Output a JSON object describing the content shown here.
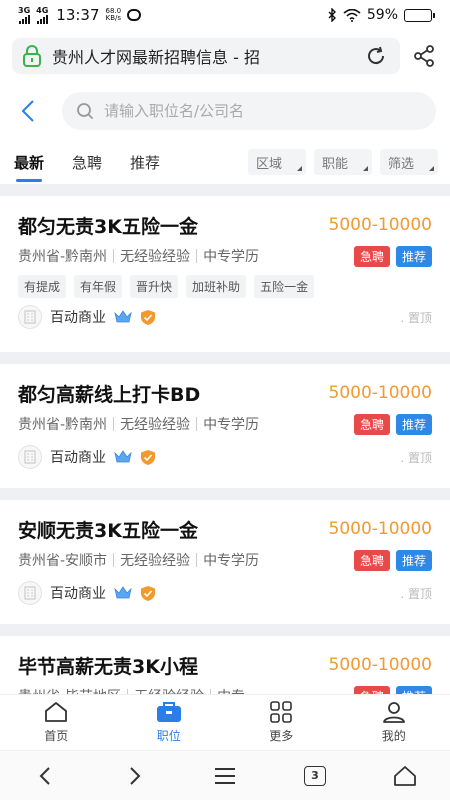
{
  "status_bar": {
    "signal1": "3G",
    "signal2": "4G",
    "time": "13:37",
    "net_speed_value": "68.0",
    "net_speed_unit": "KB/s",
    "battery": "59%",
    "battery_level": 0.59
  },
  "browser": {
    "page_title": "贵州人才网最新招聘信息 - 招",
    "tab_count": "3"
  },
  "search": {
    "placeholder": "请输入职位名/公司名"
  },
  "tabs": [
    {
      "label": "最新"
    },
    {
      "label": "急聘"
    },
    {
      "label": "推荐"
    }
  ],
  "filters": [
    {
      "label": "区域"
    },
    {
      "label": "职能"
    },
    {
      "label": "筛选"
    }
  ],
  "jobs": [
    {
      "title": "都匀无责3K五险一金",
      "salary": "5000-10000",
      "location": "贵州省-黔南州",
      "experience": "无经验经验",
      "education": "中专学历",
      "badge_urgent": "急聘",
      "badge_recommend": "推荐",
      "tags": [
        "有提成",
        "有年假",
        "晋升快",
        "加班补助",
        "五险一金"
      ],
      "company": "百动商业",
      "pin": "置顶"
    },
    {
      "title": "都匀高薪线上打卡BD",
      "salary": "5000-10000",
      "location": "贵州省-黔南州",
      "experience": "无经验经验",
      "education": "中专学历",
      "badge_urgent": "急聘",
      "badge_recommend": "推荐",
      "company": "百动商业",
      "pin": "置顶"
    },
    {
      "title": "安顺无责3K五险一金",
      "salary": "5000-10000",
      "location": "贵州省-安顺市",
      "experience": "无经验经验",
      "education": "中专学历",
      "badge_urgent": "急聘",
      "badge_recommend": "推荐",
      "company": "百动商业",
      "pin": "置顶"
    },
    {
      "title": "毕节高薪无责3K小程",
      "salary": "5000-10000",
      "location": "贵州省-毕节地区",
      "experience": "无经验经验",
      "education": "中专",
      "badge_urgent": "急聘",
      "badge_recommend": "推荐",
      "company": "",
      "pin": ""
    }
  ],
  "bottom_nav": [
    {
      "label": "首页",
      "icon": "home-icon"
    },
    {
      "label": "职位",
      "icon": "briefcase-icon"
    },
    {
      "label": "更多",
      "icon": "grid-icon"
    },
    {
      "label": "我的",
      "icon": "user-icon"
    }
  ],
  "colors": {
    "accent": "#2b7de9",
    "salary": "#f29a2e",
    "urgent": "#e84a4a",
    "recommend": "#2f87e8"
  }
}
